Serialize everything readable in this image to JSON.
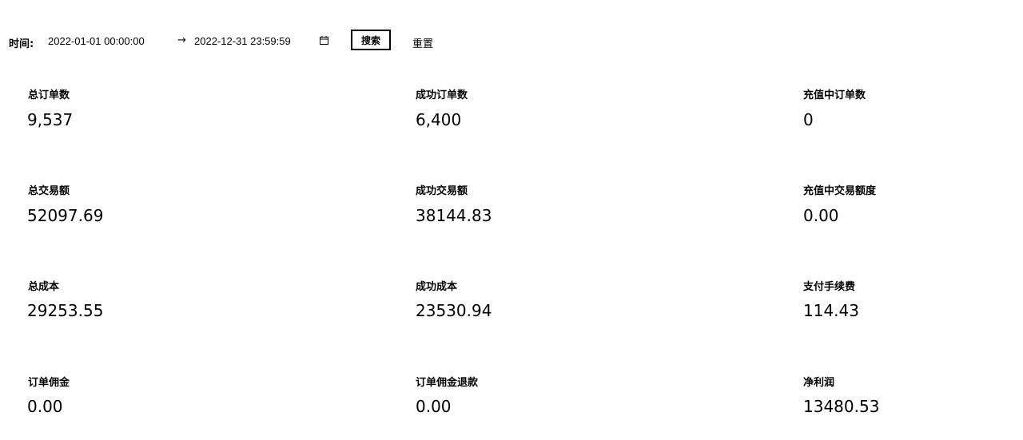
{
  "filter": {
    "time_label": "时间:",
    "start": "2022-01-01 00:00:00",
    "separator": "→",
    "end": "2022-12-31 23:59:59",
    "calendar_icon": "calendar-icon",
    "search_label": "搜索",
    "reset_label": "重置"
  },
  "stats": [
    {
      "label": "总订单数",
      "value": "9,537"
    },
    {
      "label": "成功订单数",
      "value": "6,400"
    },
    {
      "label": "充值中订单数",
      "value": "0"
    },
    {
      "label": "总交易额",
      "value": "52097.69"
    },
    {
      "label": "成功交易额",
      "value": "38144.83"
    },
    {
      "label": "充值中交易额度",
      "value": "0.00"
    },
    {
      "label": "总成本",
      "value": "29253.55"
    },
    {
      "label": "成功成本",
      "value": "23530.94"
    },
    {
      "label": "支付手续费",
      "value": "114.43"
    },
    {
      "label": "订单佣金",
      "value": "0.00"
    },
    {
      "label": "订单佣金退款",
      "value": "0.00"
    },
    {
      "label": "净利润",
      "value": "13480.53"
    }
  ]
}
